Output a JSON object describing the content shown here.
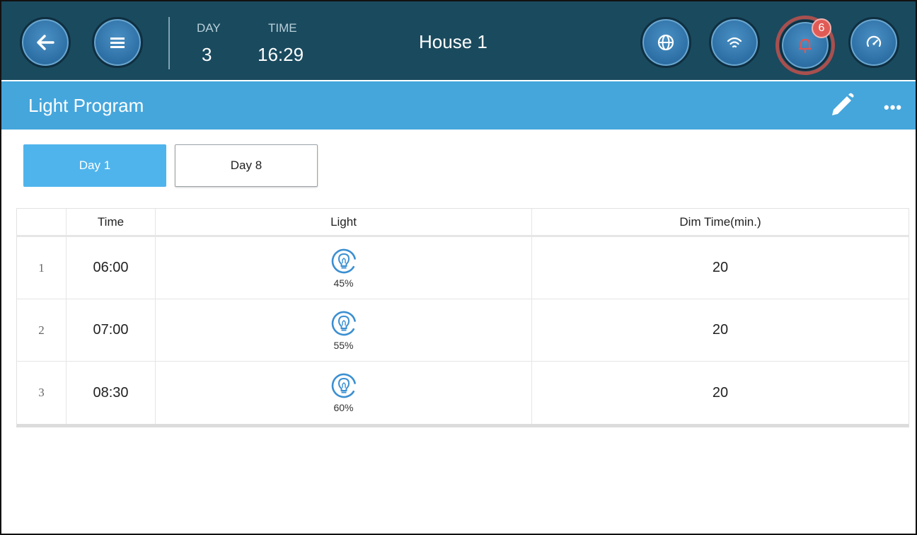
{
  "header": {
    "day_label": "DAY",
    "day_value": "3",
    "time_label": "TIME",
    "time_value": "16:29",
    "house": "House 1",
    "alarm_count": "6"
  },
  "page": {
    "title": "Light Program"
  },
  "tabs": [
    {
      "label": "Day 1",
      "active": true
    },
    {
      "label": "Day 8",
      "active": false
    }
  ],
  "table": {
    "columns": [
      "Time",
      "Light",
      "Dim Time(min.)"
    ],
    "rows": [
      {
        "index": "1",
        "time": "06:00",
        "light": "45%",
        "dim": "20"
      },
      {
        "index": "2",
        "time": "07:00",
        "light": "55%",
        "dim": "20"
      },
      {
        "index": "3",
        "time": "08:30",
        "light": "60%",
        "dim": "20"
      }
    ]
  },
  "icons": {
    "back": "arrow-left-icon",
    "menu": "hamburger-menu-icon",
    "language": "globe-icon",
    "network": "wifi-icon",
    "alarms": "bell-icon",
    "gauge": "speedometer-icon",
    "edit": "pencil-icon",
    "more": "ellipsis-icon",
    "light": "lightbulb-icon"
  },
  "colors": {
    "topbar": "#1a4a5e",
    "titlebar": "#45a6dc",
    "active_tab": "#4fb4ec",
    "button": "#2f72a8",
    "alarm_badge": "#e05b56"
  }
}
